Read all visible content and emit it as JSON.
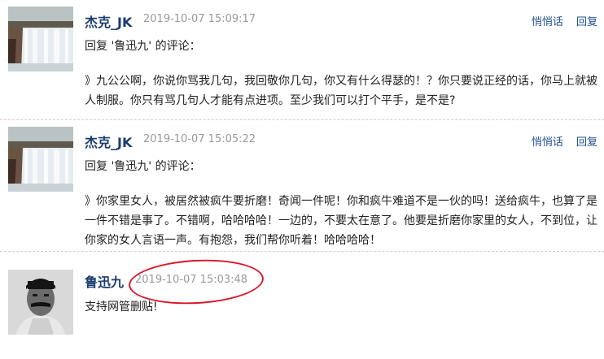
{
  "comments": [
    {
      "author": "杰克_JK",
      "time": "2019-10-07 15:09:17",
      "reply_to": "回复 '鲁迅九' 的评论：",
      "body": "》九公公啊，你说你骂我几句，我回敬你几句，你又有什么得瑟的！？你只要说正经的话，你马上就被人制服。你只有骂几句人才能有点进项。至少我们可以打个平手，是不是?",
      "actions": {
        "whisper": "悄悄话",
        "reply": "回复"
      },
      "avatar": "waterfall-avatar"
    },
    {
      "author": "杰克_JK",
      "time": "2019-10-07 15:05:22",
      "reply_to": "回复 '鲁迅九' 的评论：",
      "body": "》你家里女人，被居然被疯牛要折磨！奇闻一件呢！你和疯牛难道不是一伙的吗！送给疯牛，也算了是一件不错是事了。不错啊，哈哈哈哈！一边的，不要太在意了。他要是折磨你家里的女人，不到位，让你家的女人言语一声。有抱怨，我们帮你听着！哈哈哈哈！",
      "actions": {
        "whisper": "悄悄话",
        "reply": "回复"
      },
      "avatar": "waterfall-avatar"
    },
    {
      "author": "鲁迅九",
      "time": "2019-10-07 15:03:48",
      "body": "支持网管删贴!",
      "avatar": "portrait-avatar"
    }
  ],
  "highlight_color": "#d8182a"
}
